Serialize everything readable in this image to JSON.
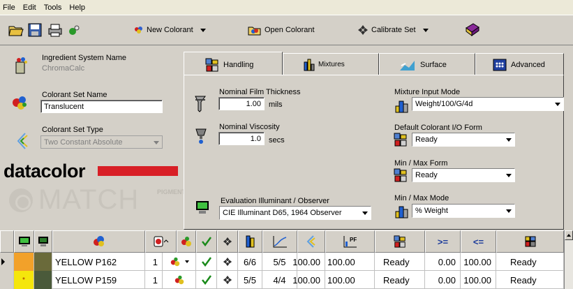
{
  "menu": [
    "File",
    "Edit",
    "Tools",
    "Help"
  ],
  "toolbar": {
    "new_colorant": "New Colorant",
    "open_colorant": "Open Colorant",
    "calibrate_set": "Calibrate Set"
  },
  "left": {
    "ingredient_system_label": "Ingredient System Name",
    "ingredient_system_value": "ChromaCalc",
    "colorant_set_name_label": "Colorant Set Name",
    "colorant_set_name_value": "Translucent",
    "colorant_set_type_label": "Colorant Set Type",
    "colorant_set_type_value": "Two Constant Absolute",
    "logo_text": "datacolor",
    "match_text": "MATCH",
    "pigment_text": "PIGMENT"
  },
  "tabs": [
    "Handling",
    "Mixtures",
    "Surface",
    "Advanced"
  ],
  "handling": {
    "film_thickness_label": "Nominal Film Thickness",
    "film_thickness_value": "1.00",
    "film_thickness_unit": "mils",
    "viscosity_label": "Nominal Viscosity",
    "viscosity_value": "1.0",
    "viscosity_unit": "secs",
    "illuminant_label": "Evaluation Illuminant / Observer",
    "illuminant_value": "CIE Illuminant D65, 1964 Observer",
    "mixture_input_label": "Mixture Input Mode",
    "mixture_input_value": "Weight/100/G/4d",
    "default_io_label": "Default Colorant I/O Form",
    "default_io_value": "Ready",
    "minmax_form_label": "Min / Max Form",
    "minmax_form_value": "Ready",
    "minmax_mode_label": "Min / Max Mode",
    "minmax_mode_value": "% Weight"
  },
  "grid": {
    "rows": [
      {
        "color": "#f2a12a",
        "color2": "#6a6a3a",
        "name": "YELLOW P162",
        "n": "1",
        "f1": "6/6",
        "f2": "5/5",
        "v1": "100.00",
        "v2": "100.00",
        "form": "Ready",
        "min": "0.00",
        "max": "100.00",
        "form2": "Ready"
      },
      {
        "color": "#f5e60c",
        "color2": "#4a5a3a",
        "name": "YELLOW P159",
        "n": "1",
        "f1": "5/5",
        "f2": "4/4",
        "v1": "100.00",
        "v2": "100.00",
        "form": "Ready",
        "min": "0.00",
        "max": "100.00",
        "form2": "Ready"
      }
    ],
    "header_icons": [
      "monitor-icon",
      "monitor-dark-icon",
      "palette-icon",
      "swatch-icon",
      "colorant-icon",
      "check-icon",
      "calibrate-icon",
      "stack-icon",
      "curve-icon",
      "brush-icon",
      "pf-icon",
      "handling-icon",
      "greater-equal-icon",
      "less-equal-icon",
      "form-icon"
    ],
    "ge_label": ">=",
    "le_label": "<="
  }
}
